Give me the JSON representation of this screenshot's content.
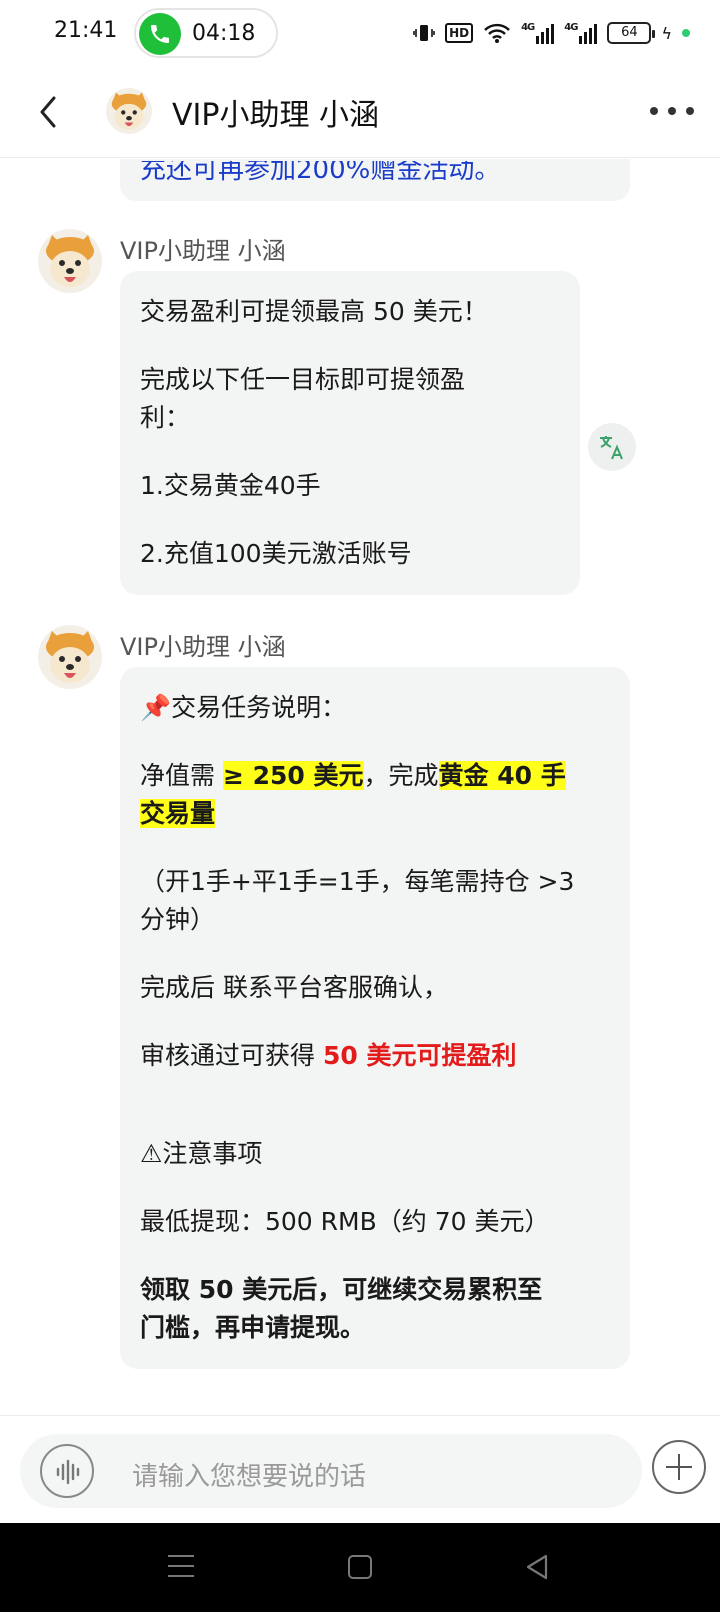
{
  "status_bar": {
    "time": "21:41",
    "call_duration": "04:18",
    "battery": "64",
    "hd_label": "HD",
    "net1": "4G",
    "net2": "4G"
  },
  "header": {
    "title": "VIP小助理 小涵"
  },
  "previous_message": {
    "text": "充还可再参加200%赠金活动。"
  },
  "messages": [
    {
      "sender": "VIP小助理 小涵",
      "lines": [
        "交易盈利可提领最高 50 美元！",
        "完成以下任一目标即可提领盈",
        "利：",
        "1.交易黄金40手",
        "2.充值100美元激活账号"
      ]
    },
    {
      "sender": "VIP小助理 小涵",
      "title": "📌交易任务说明：",
      "line1_a": "净值需 ",
      "line1_hl1": "≥ 250 美元",
      "line1_b": "，完成",
      "line1_hl2": "黄金 40 手",
      "line1_hl3": "交易量",
      "line2_a": "（开1手+平1手=1手，每笔需持仓 >3",
      "line2_b": "分钟）",
      "line3": "完成后 联系平台客服确认，",
      "line4_a": "审核通过可获得 ",
      "line4_red": "50 美元可提盈利",
      "line5": "⚠注意事项",
      "line6": "最低提现：500 RMB（约 70 美元）",
      "line7_a": "领取 50 美元后，可继续交易累积至",
      "line7_b": "门槛，再申请提现。"
    }
  ],
  "input": {
    "placeholder": "请输入您想要说的话"
  },
  "colors": {
    "bubble": "#f3f4f4",
    "highlight": "#ffff1a",
    "red": "#e31b1b",
    "link_blue": "#1a3cc8",
    "call_green": "#1fbf3a"
  }
}
